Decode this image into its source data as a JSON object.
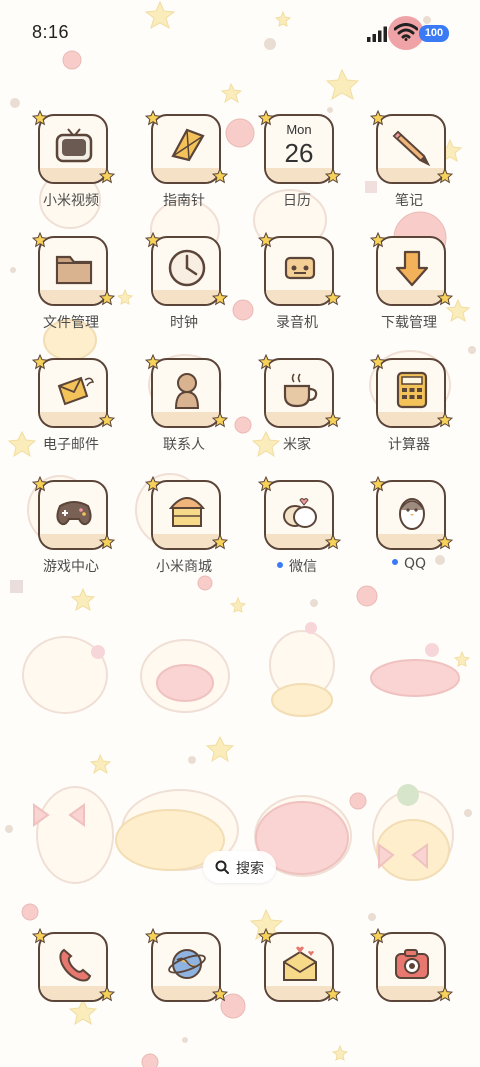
{
  "status_bar": {
    "time": "8:16",
    "battery": "100"
  },
  "apps": [
    {
      "label": "小米视频",
      "icon": "tv-icon"
    },
    {
      "label": "指南针",
      "icon": "kite-compass-icon"
    },
    {
      "label": "日历",
      "icon": "calendar-icon",
      "month": "Mon",
      "day": "26"
    },
    {
      "label": "笔记",
      "icon": "pencil-icon"
    },
    {
      "label": "文件管理",
      "icon": "folder-icon"
    },
    {
      "label": "时钟",
      "icon": "clock-icon"
    },
    {
      "label": "录音机",
      "icon": "recorder-icon"
    },
    {
      "label": "下载管理",
      "icon": "download-icon"
    },
    {
      "label": "电子邮件",
      "icon": "winged-mail-icon"
    },
    {
      "label": "联系人",
      "icon": "contact-icon"
    },
    {
      "label": "米家",
      "icon": "coffee-cup-icon"
    },
    {
      "label": "计算器",
      "icon": "calculator-icon"
    },
    {
      "label": "游戏中心",
      "icon": "gamepad-icon"
    },
    {
      "label": "小米商城",
      "icon": "shop-icon"
    },
    {
      "label": "微信",
      "icon": "wechat-icon",
      "dot": true
    },
    {
      "label": "QQ",
      "icon": "penguin-icon",
      "dot": true
    }
  ],
  "dock": [
    {
      "icon": "phone-icon"
    },
    {
      "icon": "planet-browser-icon"
    },
    {
      "icon": "message-envelope-icon"
    },
    {
      "icon": "camera-icon"
    }
  ],
  "search": {
    "label": "搜索"
  },
  "colors": {
    "accent": "#3a7bf5",
    "tile_border": "#5b4438",
    "wifi_bg": "#f0a3a6",
    "star": "#f7d25a"
  }
}
